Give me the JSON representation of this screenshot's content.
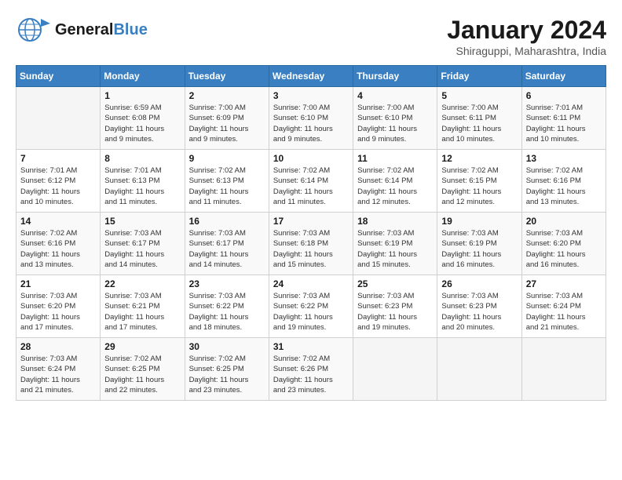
{
  "header": {
    "logo_general": "General",
    "logo_blue": "Blue",
    "month_title": "January 2024",
    "location": "Shiraguppi, Maharashtra, India"
  },
  "days_of_week": [
    "Sunday",
    "Monday",
    "Tuesday",
    "Wednesday",
    "Thursday",
    "Friday",
    "Saturday"
  ],
  "weeks": [
    [
      {
        "day": "",
        "info": ""
      },
      {
        "day": "1",
        "info": "Sunrise: 6:59 AM\nSunset: 6:08 PM\nDaylight: 11 hours\nand 9 minutes."
      },
      {
        "day": "2",
        "info": "Sunrise: 7:00 AM\nSunset: 6:09 PM\nDaylight: 11 hours\nand 9 minutes."
      },
      {
        "day": "3",
        "info": "Sunrise: 7:00 AM\nSunset: 6:10 PM\nDaylight: 11 hours\nand 9 minutes."
      },
      {
        "day": "4",
        "info": "Sunrise: 7:00 AM\nSunset: 6:10 PM\nDaylight: 11 hours\nand 9 minutes."
      },
      {
        "day": "5",
        "info": "Sunrise: 7:00 AM\nSunset: 6:11 PM\nDaylight: 11 hours\nand 10 minutes."
      },
      {
        "day": "6",
        "info": "Sunrise: 7:01 AM\nSunset: 6:11 PM\nDaylight: 11 hours\nand 10 minutes."
      }
    ],
    [
      {
        "day": "7",
        "info": "Sunrise: 7:01 AM\nSunset: 6:12 PM\nDaylight: 11 hours\nand 10 minutes."
      },
      {
        "day": "8",
        "info": "Sunrise: 7:01 AM\nSunset: 6:13 PM\nDaylight: 11 hours\nand 11 minutes."
      },
      {
        "day": "9",
        "info": "Sunrise: 7:02 AM\nSunset: 6:13 PM\nDaylight: 11 hours\nand 11 minutes."
      },
      {
        "day": "10",
        "info": "Sunrise: 7:02 AM\nSunset: 6:14 PM\nDaylight: 11 hours\nand 11 minutes."
      },
      {
        "day": "11",
        "info": "Sunrise: 7:02 AM\nSunset: 6:14 PM\nDaylight: 11 hours\nand 12 minutes."
      },
      {
        "day": "12",
        "info": "Sunrise: 7:02 AM\nSunset: 6:15 PM\nDaylight: 11 hours\nand 12 minutes."
      },
      {
        "day": "13",
        "info": "Sunrise: 7:02 AM\nSunset: 6:16 PM\nDaylight: 11 hours\nand 13 minutes."
      }
    ],
    [
      {
        "day": "14",
        "info": "Sunrise: 7:02 AM\nSunset: 6:16 PM\nDaylight: 11 hours\nand 13 minutes."
      },
      {
        "day": "15",
        "info": "Sunrise: 7:03 AM\nSunset: 6:17 PM\nDaylight: 11 hours\nand 14 minutes."
      },
      {
        "day": "16",
        "info": "Sunrise: 7:03 AM\nSunset: 6:17 PM\nDaylight: 11 hours\nand 14 minutes."
      },
      {
        "day": "17",
        "info": "Sunrise: 7:03 AM\nSunset: 6:18 PM\nDaylight: 11 hours\nand 15 minutes."
      },
      {
        "day": "18",
        "info": "Sunrise: 7:03 AM\nSunset: 6:19 PM\nDaylight: 11 hours\nand 15 minutes."
      },
      {
        "day": "19",
        "info": "Sunrise: 7:03 AM\nSunset: 6:19 PM\nDaylight: 11 hours\nand 16 minutes."
      },
      {
        "day": "20",
        "info": "Sunrise: 7:03 AM\nSunset: 6:20 PM\nDaylight: 11 hours\nand 16 minutes."
      }
    ],
    [
      {
        "day": "21",
        "info": "Sunrise: 7:03 AM\nSunset: 6:20 PM\nDaylight: 11 hours\nand 17 minutes."
      },
      {
        "day": "22",
        "info": "Sunrise: 7:03 AM\nSunset: 6:21 PM\nDaylight: 11 hours\nand 17 minutes."
      },
      {
        "day": "23",
        "info": "Sunrise: 7:03 AM\nSunset: 6:22 PM\nDaylight: 11 hours\nand 18 minutes."
      },
      {
        "day": "24",
        "info": "Sunrise: 7:03 AM\nSunset: 6:22 PM\nDaylight: 11 hours\nand 19 minutes."
      },
      {
        "day": "25",
        "info": "Sunrise: 7:03 AM\nSunset: 6:23 PM\nDaylight: 11 hours\nand 19 minutes."
      },
      {
        "day": "26",
        "info": "Sunrise: 7:03 AM\nSunset: 6:23 PM\nDaylight: 11 hours\nand 20 minutes."
      },
      {
        "day": "27",
        "info": "Sunrise: 7:03 AM\nSunset: 6:24 PM\nDaylight: 11 hours\nand 21 minutes."
      }
    ],
    [
      {
        "day": "28",
        "info": "Sunrise: 7:03 AM\nSunset: 6:24 PM\nDaylight: 11 hours\nand 21 minutes."
      },
      {
        "day": "29",
        "info": "Sunrise: 7:02 AM\nSunset: 6:25 PM\nDaylight: 11 hours\nand 22 minutes."
      },
      {
        "day": "30",
        "info": "Sunrise: 7:02 AM\nSunset: 6:25 PM\nDaylight: 11 hours\nand 23 minutes."
      },
      {
        "day": "31",
        "info": "Sunrise: 7:02 AM\nSunset: 6:26 PM\nDaylight: 11 hours\nand 23 minutes."
      },
      {
        "day": "",
        "info": ""
      },
      {
        "day": "",
        "info": ""
      },
      {
        "day": "",
        "info": ""
      }
    ]
  ]
}
